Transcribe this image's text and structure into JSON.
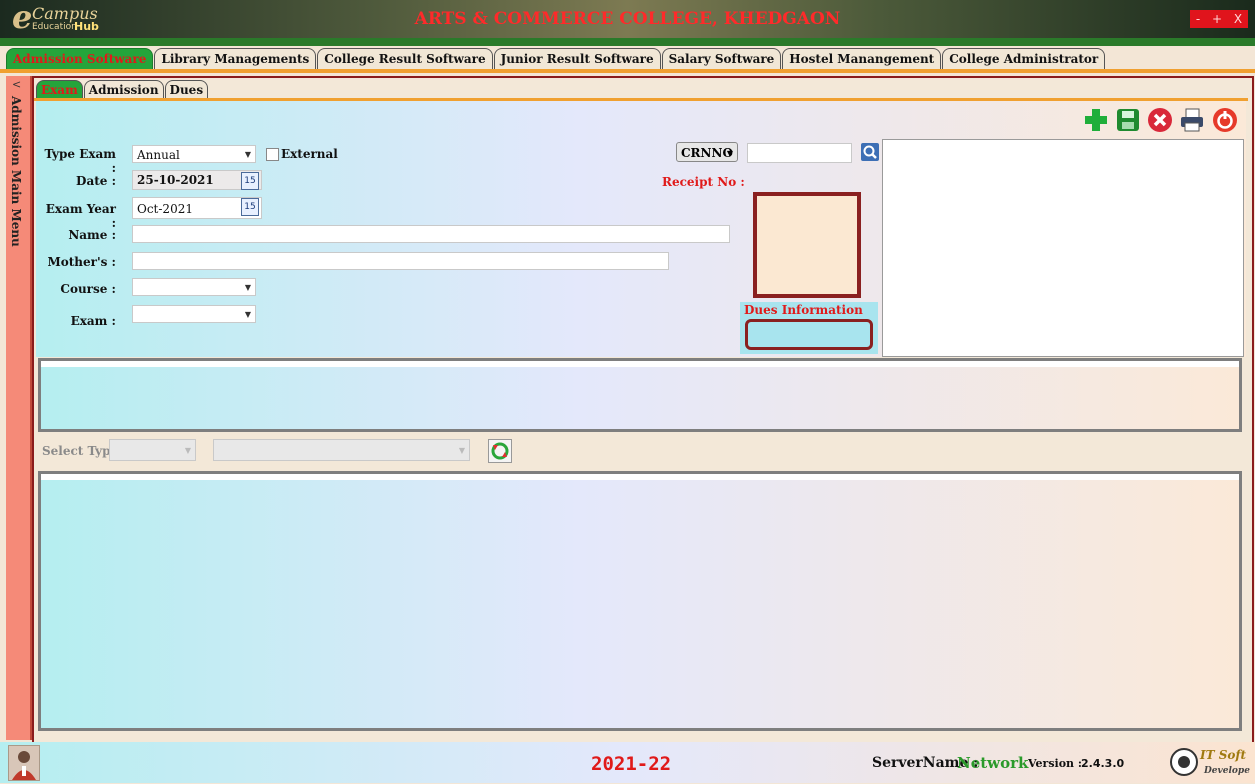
{
  "app": {
    "logo_e": "e",
    "logo_campus": "Campus",
    "logo_edu": "Education",
    "logo_hub": "Hub",
    "college_title": "ARTS & COMMERCE COLLEGE, KHEDGAON",
    "window_controls": [
      "-",
      "+",
      "X"
    ]
  },
  "top_tabs": [
    {
      "label": "Admission Software",
      "active": true
    },
    {
      "label": "Library Managements",
      "active": false
    },
    {
      "label": "College Result Software",
      "active": false
    },
    {
      "label": "Junior Result Software",
      "active": false
    },
    {
      "label": "Salary Software",
      "active": false
    },
    {
      "label": "Hostel Manangement",
      "active": false
    },
    {
      "label": "College Administrator",
      "active": false
    }
  ],
  "sidebar": {
    "arrow": "<",
    "label": "Admission Main Menu"
  },
  "sub_tabs": [
    {
      "label": "Exam",
      "active": true
    },
    {
      "label": "Admission",
      "active": false
    },
    {
      "label": "Dues",
      "active": false
    }
  ],
  "form": {
    "type_exam_label": "Type Exam :",
    "type_exam_value": "Annual",
    "external_label": "External",
    "date_label": "Date :",
    "date_value": "25-10-2021",
    "exam_year_label": "Exam Year :",
    "exam_year_value": "Oct-2021",
    "name_label": "Name :",
    "name_value": "",
    "mothers_label": "Mother's :",
    "mothers_value": "",
    "course_label": "Course :",
    "course_value": "",
    "exam_label": "Exam :",
    "exam_value": "",
    "crnno_label": "CRNNO",
    "crnno_value": "",
    "receipt_label": "Receipt No :",
    "dues_info_label": "Dues Information",
    "cal_icon_text": "15"
  },
  "select_type": {
    "label": "Select Type",
    "type_value": "",
    "second_value": ""
  },
  "toolbar": {
    "icons": [
      "add-icon",
      "save-icon",
      "cancel-icon",
      "print-icon",
      "power-icon"
    ]
  },
  "status": {
    "year": "2021-22",
    "server_label": "ServerName :",
    "server_value": "Network",
    "version_label": "Version :",
    "version_value": "2.4.3.0",
    "brand": "IT Soft Developers"
  },
  "colors": {
    "accent_red": "#e01a1a",
    "active_tab_green": "#24a53b",
    "server_green": "#2a9a2a",
    "frame_maroon": "#8a1c1c"
  }
}
